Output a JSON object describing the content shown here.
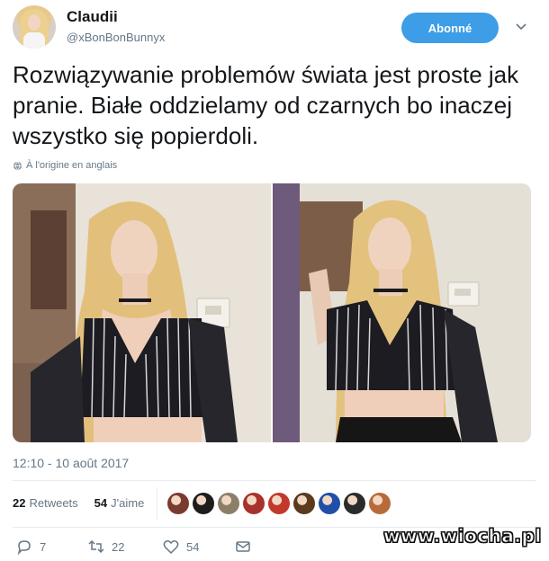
{
  "user": {
    "display_name": "Claudii",
    "handle": "@xBonBonBunnyx",
    "follow_label": "Abonné"
  },
  "tweet": {
    "text": "Rozwiązywanie problemów świata jest proste jak pranie. Białe oddzielamy od czarnych bo inaczej wszystko się popierdoli.",
    "translation_note": "À l'origine en anglais",
    "timestamp": "12:10 - 10 août 2017"
  },
  "stats": {
    "retweets_count": "22",
    "retweets_label": "Retweets",
    "likes_count": "54",
    "likes_label": "J'aime"
  },
  "likers": [
    {
      "icon": "avatar-1",
      "color": "#7a3b2e"
    },
    {
      "icon": "avatar-2",
      "color": "#1d1d1d"
    },
    {
      "icon": "avatar-3",
      "color": "#8c7f6a"
    },
    {
      "icon": "avatar-4",
      "color": "#a8322d"
    },
    {
      "icon": "avatar-5",
      "color": "#c0392b"
    },
    {
      "icon": "avatar-6",
      "color": "#5b3a1e"
    },
    {
      "icon": "avatar-7",
      "color": "#1f4fa8"
    },
    {
      "icon": "avatar-8",
      "color": "#2b2b2b"
    },
    {
      "icon": "avatar-9",
      "color": "#b86b3a"
    }
  ],
  "actions": {
    "reply_count": "7",
    "retweet_count": "22",
    "like_count": "54"
  },
  "watermark": "www.wiocha.pl",
  "colors": {
    "accent": "#3d9de6",
    "text": "#14171a",
    "muted": "#657786"
  }
}
